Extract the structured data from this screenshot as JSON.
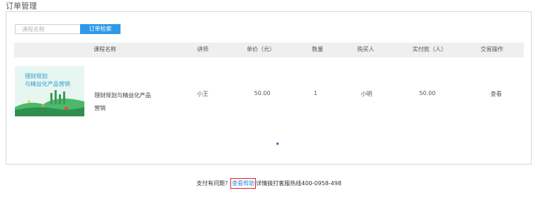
{
  "page": {
    "title": "订单管理"
  },
  "search": {
    "placeholder": "课程名称",
    "button_label": "订单检索"
  },
  "table": {
    "columns": [
      "课程名称",
      "讲师",
      "单价（元）",
      "数量",
      "购买人",
      "实付款（人）",
      "交易操作"
    ],
    "rows": [
      {
        "thumb_line1": "理财规划",
        "thumb_line2": "与精益化产品营销",
        "course_name": "理财规划与精益化产品营销",
        "teacher": "小王",
        "price": "50.00",
        "quantity": "1",
        "buyer": "小明",
        "paid": "50.00",
        "action": "查看"
      }
    ]
  },
  "footer": {
    "prefix": "支付有问题？",
    "help_link": "查看帮助",
    "suffix": "详情拨打客服热线400-0958-498"
  },
  "colors": {
    "accent": "#2d9ae8",
    "header_bg": "#efefef",
    "link": "#2d8fd8",
    "highlight_border": "#e0202a"
  }
}
